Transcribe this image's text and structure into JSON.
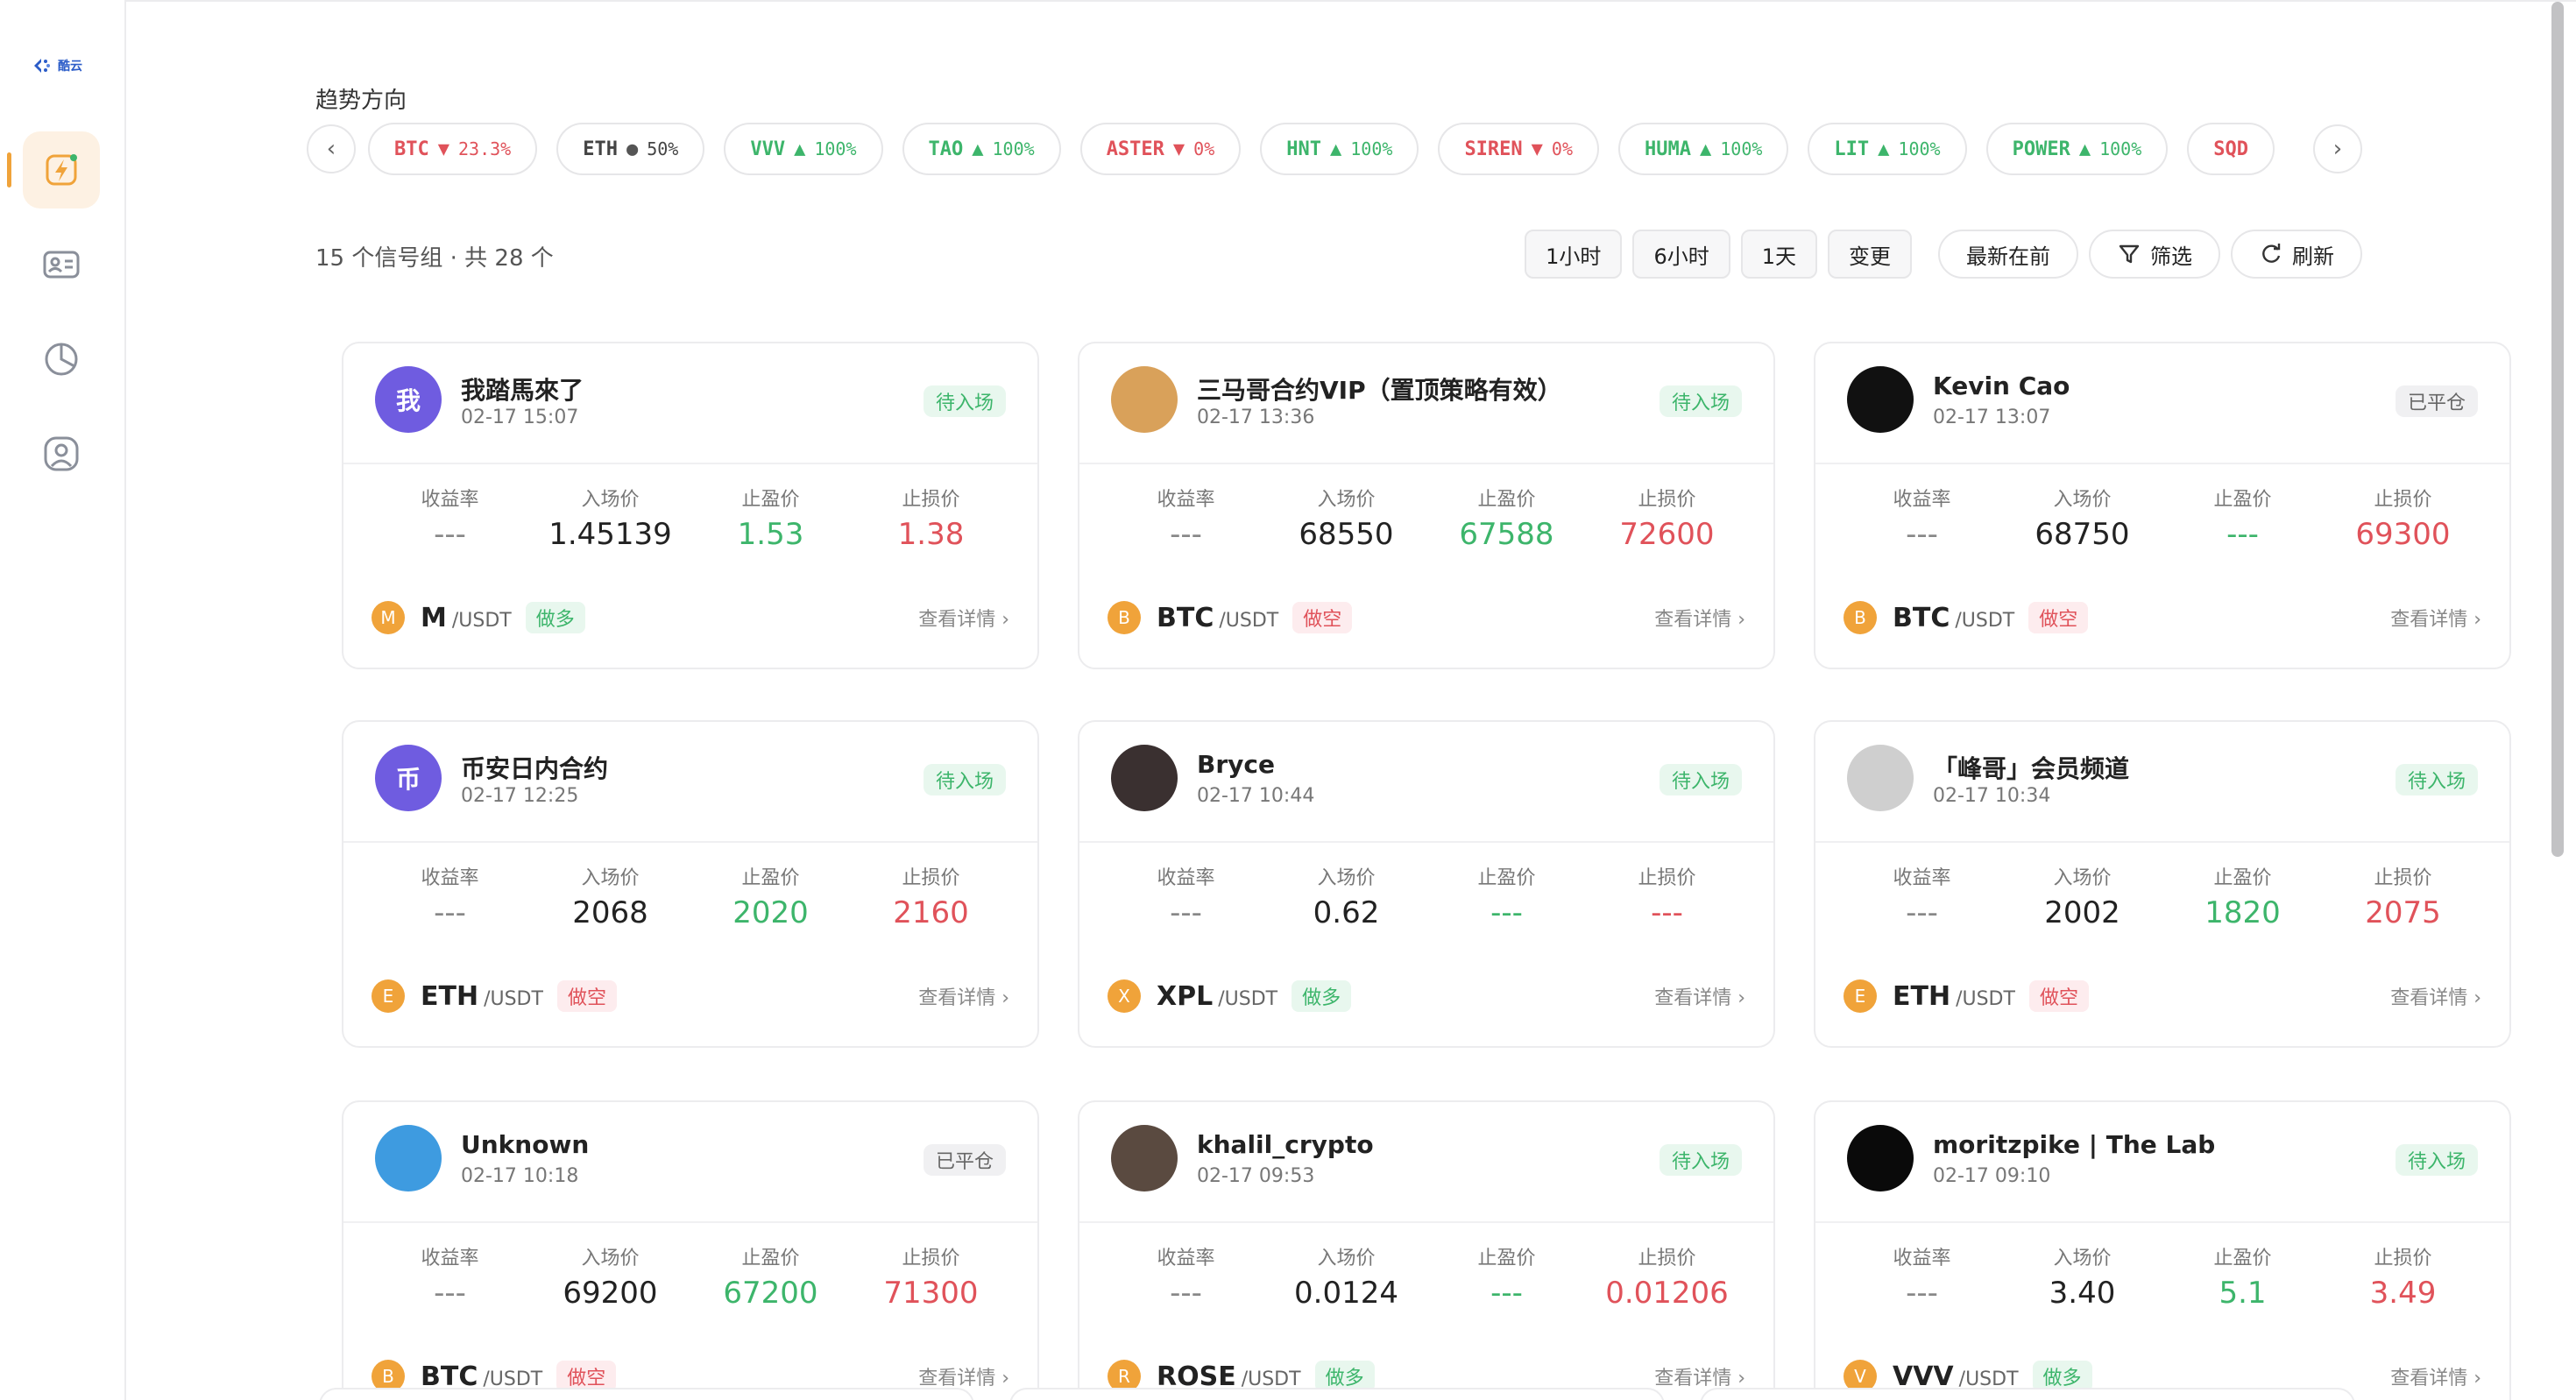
{
  "brand": {
    "logo_text": "酷云"
  },
  "sidebar": {
    "items": [
      {
        "name": "signals",
        "icon": "lightning-icon",
        "active": true
      },
      {
        "name": "profile-card",
        "icon": "id-card-icon",
        "active": false
      },
      {
        "name": "stats",
        "icon": "pie-chart-icon",
        "active": false
      },
      {
        "name": "account",
        "icon": "user-icon",
        "active": false
      }
    ]
  },
  "trend": {
    "title": "趋势方向",
    "pills": [
      {
        "symbol": "BTC",
        "arrow": "▼",
        "pct": "23.3%",
        "dir": "down"
      },
      {
        "symbol": "ETH",
        "arrow": "●",
        "pct": "50%",
        "dir": "flat"
      },
      {
        "symbol": "VVV",
        "arrow": "▲",
        "pct": "100%",
        "dir": "up"
      },
      {
        "symbol": "TAO",
        "arrow": "▲",
        "pct": "100%",
        "dir": "up"
      },
      {
        "symbol": "ASTER",
        "arrow": "▼",
        "pct": "0%",
        "dir": "down"
      },
      {
        "symbol": "HNT",
        "arrow": "▲",
        "pct": "100%",
        "dir": "up"
      },
      {
        "symbol": "SIREN",
        "arrow": "▼",
        "pct": "0%",
        "dir": "down"
      },
      {
        "symbol": "HUMA",
        "arrow": "▲",
        "pct": "100%",
        "dir": "up"
      },
      {
        "symbol": "LIT",
        "arrow": "▲",
        "pct": "100%",
        "dir": "up"
      },
      {
        "symbol": "POWER",
        "arrow": "▲",
        "pct": "100%",
        "dir": "up"
      },
      {
        "symbol": "SQD",
        "arrow": "",
        "pct": "",
        "dir": "down"
      }
    ]
  },
  "summary": "15 个信号组 · 共 28 个",
  "toolbar": {
    "tf_1h": "1小时",
    "tf_6h": "6小时",
    "tf_1d": "1天",
    "change": "变更",
    "sort": "最新在前",
    "filter": "筛选",
    "refresh": "刷新"
  },
  "labels": {
    "yield": "收益率",
    "entry": "入场价",
    "take_profit": "止盈价",
    "stop_loss": "止损价",
    "detail": "查看详情 ›",
    "quote": "/USDT"
  },
  "cards": [
    {
      "name": "我踏馬來了",
      "time": "02-17 15:07",
      "status": "待入场",
      "status_type": "wait",
      "avatar_text": "我",
      "avatar_color": "#6f5ce0",
      "yield": "---",
      "entry": "1.45139",
      "tp": "1.53",
      "sl": "1.38",
      "coin_letter": "M",
      "pair": "M",
      "dir": "做多",
      "dir_type": "long"
    },
    {
      "name": "三马哥合约VIP（置顶策略有效）",
      "time": "02-17 13:36",
      "status": "待入场",
      "status_type": "wait",
      "avatar_text": "",
      "avatar_color": "#d9a15a",
      "yield": "---",
      "entry": "68550",
      "tp": "67588",
      "sl": "72600",
      "coin_letter": "B",
      "pair": "BTC",
      "dir": "做空",
      "dir_type": "short"
    },
    {
      "name": "Kevin Cao",
      "time": "02-17 13:07",
      "status": "已平仓",
      "status_type": "closed",
      "avatar_text": "",
      "avatar_color": "#111111",
      "yield": "---",
      "entry": "68750",
      "tp": "---",
      "sl": "69300",
      "coin_letter": "B",
      "pair": "BTC",
      "dir": "做空",
      "dir_type": "short"
    },
    {
      "name": "币安日内合约",
      "time": "02-17 12:25",
      "status": "待入场",
      "status_type": "wait",
      "avatar_text": "币",
      "avatar_color": "#6f5ce0",
      "yield": "---",
      "entry": "2068",
      "tp": "2020",
      "sl": "2160",
      "coin_letter": "E",
      "pair": "ETH",
      "dir": "做空",
      "dir_type": "short"
    },
    {
      "name": "Bryce",
      "time": "02-17 10:44",
      "status": "待入场",
      "status_type": "wait",
      "avatar_text": "",
      "avatar_color": "#3a3030",
      "yield": "---",
      "entry": "0.62",
      "tp": "---",
      "sl": "---",
      "coin_letter": "X",
      "pair": "XPL",
      "dir": "做多",
      "dir_type": "long"
    },
    {
      "name": "「峰哥」会员频道",
      "time": "02-17 10:34",
      "status": "待入场",
      "status_type": "wait",
      "avatar_text": "",
      "avatar_color": "#cfcfcf",
      "yield": "---",
      "entry": "2002",
      "tp": "1820",
      "sl": "2075",
      "coin_letter": "E",
      "pair": "ETH",
      "dir": "做空",
      "dir_type": "short"
    },
    {
      "name": "Unknown",
      "time": "02-17 10:18",
      "status": "已平仓",
      "status_type": "closed",
      "avatar_text": "",
      "avatar_color": "#3e9be0",
      "yield": "---",
      "entry": "69200",
      "tp": "67200",
      "sl": "71300",
      "coin_letter": "B",
      "pair": "BTC",
      "dir": "做空",
      "dir_type": "short"
    },
    {
      "name": "khalil_crypto",
      "time": "02-17 09:53",
      "status": "待入场",
      "status_type": "wait",
      "avatar_text": "",
      "avatar_color": "#5a4a40",
      "yield": "---",
      "entry": "0.0124",
      "tp": "---",
      "sl": "0.01206",
      "coin_letter": "R",
      "pair": "ROSE",
      "dir": "做多",
      "dir_type": "long"
    },
    {
      "name": "moritzpike | The Lab",
      "time": "02-17 09:10",
      "status": "待入场",
      "status_type": "wait",
      "avatar_text": "",
      "avatar_color": "#0a0a0a",
      "yield": "---",
      "entry": "3.40",
      "tp": "5.1",
      "sl": "3.49",
      "coin_letter": "V",
      "pair": "VVV",
      "dir": "做多",
      "dir_type": "long"
    }
  ],
  "colors": {
    "up": "#3db56b",
    "down": "#e0525a",
    "accent": "#f0a33a",
    "brand": "#2b5cc8"
  }
}
